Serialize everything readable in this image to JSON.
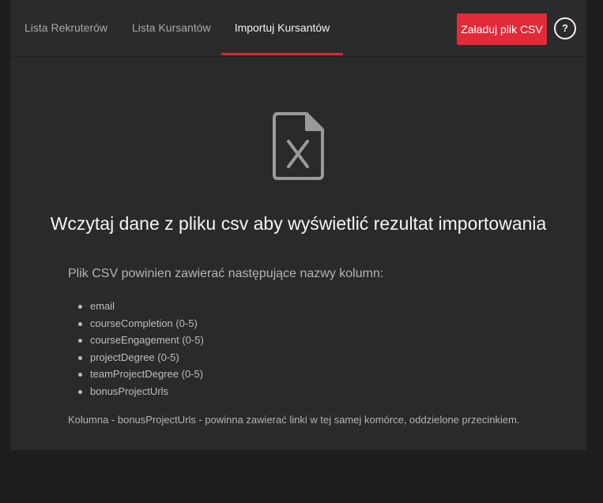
{
  "nav": {
    "tabs": [
      {
        "label": "Lista Rekruterów",
        "active": false
      },
      {
        "label": "Lista Kursantów",
        "active": false
      },
      {
        "label": "Importuj Kursantów",
        "active": true
      }
    ],
    "upload_label": "Załaduj plik CSV",
    "help_label": "?"
  },
  "main": {
    "icon": "file-excel-icon",
    "heading": "Wczytaj dane z pliku csv aby wyświetlić rezultat importowania",
    "intro": "Plik CSV powinien zawierać następujące nazwy kolumn:",
    "columns": [
      "email",
      "courseCompletion (0-5)",
      "courseEngagement (0-5)",
      "projectDegree (0-5)",
      "teamProjectDegree (0-5)",
      "bonusProjectUrls"
    ],
    "note": "Kolumna - bonusProjectUrls - powinna zawierać linki w tej samej komórce, oddzielone przecinkiem."
  },
  "colors": {
    "page_bg": "#1e1e1f",
    "panel_bg": "#292a2b",
    "accent": "#e22a38",
    "active_underline": "#d32a34"
  }
}
